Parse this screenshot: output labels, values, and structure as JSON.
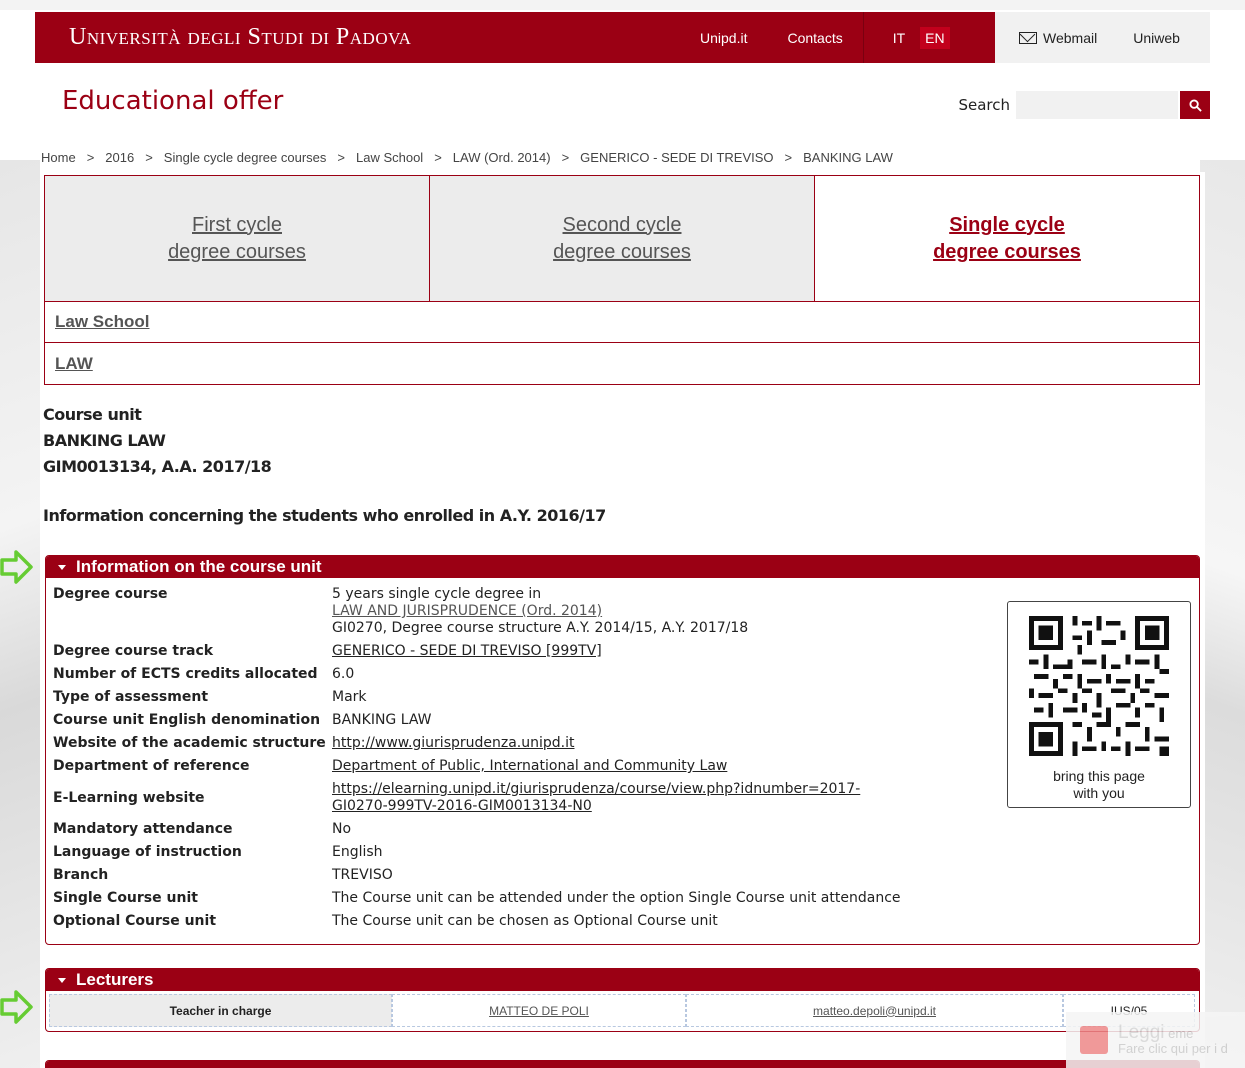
{
  "topbar": {
    "university": "Università degli Studi di Padova",
    "nav": [
      "Unipd.it",
      "Contacts"
    ],
    "lang_it": "IT",
    "lang_en": "EN",
    "webmail": "Webmail",
    "uniweb": "Uniweb"
  },
  "header": {
    "title": "Educational offer",
    "search_label": "Search",
    "search_placeholder": ""
  },
  "breadcrumb": [
    "Home",
    "2016",
    "Single cycle degree courses",
    "Law School",
    "LAW (Ord. 2014)",
    "GENERICO - SEDE DI TREVISO",
    "BANKING LAW"
  ],
  "cycle_tabs": [
    {
      "line1": "First cycle",
      "line2": "degree courses"
    },
    {
      "line1": "Second cycle",
      "line2": "degree courses"
    },
    {
      "line1": "Single cycle",
      "line2": "degree courses"
    }
  ],
  "school": "Law School",
  "law": "LAW",
  "course": {
    "label": "Course unit",
    "name": "BANKING LAW",
    "code": "GIM0013134, A.A. 2017/18",
    "enrollment_info": "Information concerning the students who enrolled in A.Y. 2016/17"
  },
  "info_panel": {
    "title": "Information on the course unit",
    "rows": [
      {
        "label": "Degree course",
        "v1": "5 years single cycle degree in",
        "v2": "LAW AND JURISPRUDENCE (Ord. 2014)",
        "v3": "GI0270, Degree course structure A.Y. 2014/15, A.Y. 2017/18"
      },
      {
        "label": "Degree course track",
        "value": "GENERICO - SEDE DI TREVISO [999TV]"
      },
      {
        "label": "Number of ECTS credits allocated",
        "value": "6.0"
      },
      {
        "label": "Type of assessment",
        "value": "Mark"
      },
      {
        "label": "Course unit English denomination",
        "value": "BANKING LAW"
      },
      {
        "label": "Website of the academic structure",
        "value": "http://www.giurisprudenza.unipd.it"
      },
      {
        "label": "Department of reference",
        "value": "Department of Public, International and Community Law"
      },
      {
        "label": "E-Learning website",
        "v1": "https://elearning.unipd.it/giurisprudenza/course/view.php?idnumber=2017-",
        "v2": "GI0270-999TV-2016-GIM0013134-N0"
      },
      {
        "label": "Mandatory attendance",
        "value": "No"
      },
      {
        "label": "Language of instruction",
        "value": "English"
      },
      {
        "label": "Branch",
        "value": "TREVISO"
      },
      {
        "label": "Single Course unit",
        "value": "The Course unit can be attended under the option Single Course unit attendance"
      },
      {
        "label": "Optional Course unit",
        "value": "The Course unit can be chosen as Optional Course unit"
      }
    ],
    "qr_caption_1": "bring this page",
    "qr_caption_2": "with you"
  },
  "lecturers": {
    "title": "Lecturers",
    "role": "Teacher in charge",
    "name": "MATTEO DE POLI",
    "email": "matteo.depoli@unipd.it",
    "ssd": "IUS/05"
  },
  "notification": {
    "line1": "Leggi",
    "line1b": "eme",
    "line2": "Fare clic qui per i d"
  },
  "colors": {
    "brand": "#9b0014",
    "arrow": "#66cc33"
  }
}
